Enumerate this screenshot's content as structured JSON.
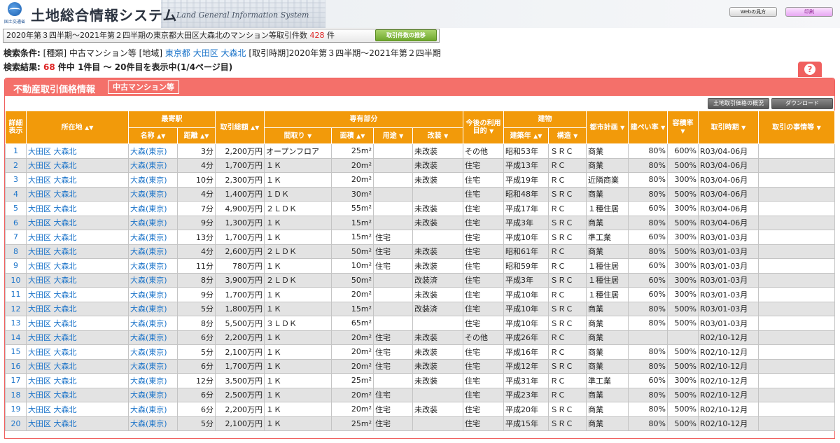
{
  "header": {
    "title": "土地総合情報システム",
    "subtitle": "Land General Information System",
    "logo_text": "国土交通省",
    "help_button": "Webの見方",
    "print_button": "印刷"
  },
  "summary": {
    "text": "2020年第３四半期～2021年第２四半期の東京都大田区大森北のマンション等取引件数",
    "count": "428",
    "unit": "件",
    "trend_button": "取引件数の推移"
  },
  "criteria": {
    "label": "検索条件:",
    "type": "[種類] 中古マンション等",
    "region_label": "[地域]",
    "region_pref": "東京都",
    "region_city": "大田区",
    "region_area": "大森北",
    "period": "[取引時期]2020年第３四半期～2021年第２四半期"
  },
  "results": {
    "label": "検索結果:",
    "count": "68",
    "text": "件中 1件目 ～ 20件目を表示中(1/4ページ目)"
  },
  "panel": {
    "title": "不動産取引価格情報",
    "tag": "中古マンション等",
    "land_button": "土地取引価格の概況",
    "download_button": "ダウンロード"
  },
  "table": {
    "headers": {
      "detail": "詳細表示",
      "location": "所在地",
      "station": "最寄駅",
      "station_name": "名称",
      "distance": "距離",
      "price": "取引総額",
      "section": "専有部分",
      "layout": "間取り",
      "area": "面積",
      "use": "用途",
      "renovation": "改装",
      "future_use": "今後の利用目的",
      "building": "建物",
      "built_year": "建築年",
      "structure": "構造",
      "city_plan": "都市計画",
      "coverage": "建ぺい率",
      "floor_ratio": "容積率",
      "period": "取引時期",
      "circumstances": "取引の事情等"
    },
    "rows": [
      {
        "no": "1",
        "loc": "大田区 大森北",
        "st": "大森(東京)",
        "dist": "3分",
        "price": "2,200万円",
        "layout": "オープンフロア",
        "area": "25m²",
        "use": "",
        "reno": "未改装",
        "future": "その他",
        "year": "昭和53年",
        "struct": "ＳＲＣ",
        "plan": "商業",
        "cov": "80%",
        "far": "600%",
        "period": "R03/04-06月"
      },
      {
        "no": "2",
        "loc": "大田区 大森北",
        "st": "大森(東京)",
        "dist": "4分",
        "price": "1,700万円",
        "layout": "１Ｋ",
        "area": "20m²",
        "use": "",
        "reno": "未改装",
        "future": "住宅",
        "year": "平成13年",
        "struct": "ＲＣ",
        "plan": "商業",
        "cov": "80%",
        "far": "500%",
        "period": "R03/04-06月"
      },
      {
        "no": "3",
        "loc": "大田区 大森北",
        "st": "大森(東京)",
        "dist": "10分",
        "price": "2,300万円",
        "layout": "１Ｋ",
        "area": "20m²",
        "use": "",
        "reno": "未改装",
        "future": "住宅",
        "year": "平成19年",
        "struct": "ＲＣ",
        "plan": "近隣商業",
        "cov": "80%",
        "far": "300%",
        "period": "R03/04-06月"
      },
      {
        "no": "4",
        "loc": "大田区 大森北",
        "st": "大森(東京)",
        "dist": "4分",
        "price": "1,400万円",
        "layout": "１ＤＫ",
        "area": "30m²",
        "use": "",
        "reno": "",
        "future": "住宅",
        "year": "昭和48年",
        "struct": "ＳＲＣ",
        "plan": "商業",
        "cov": "80%",
        "far": "500%",
        "period": "R03/04-06月"
      },
      {
        "no": "5",
        "loc": "大田区 大森北",
        "st": "大森(東京)",
        "dist": "7分",
        "price": "4,900万円",
        "layout": "２ＬＤＫ",
        "area": "55m²",
        "use": "",
        "reno": "未改装",
        "future": "住宅",
        "year": "平成17年",
        "struct": "ＲＣ",
        "plan": "１種住居",
        "cov": "60%",
        "far": "300%",
        "period": "R03/04-06月"
      },
      {
        "no": "6",
        "loc": "大田区 大森北",
        "st": "大森(東京)",
        "dist": "9分",
        "price": "1,300万円",
        "layout": "１Ｋ",
        "area": "15m²",
        "use": "",
        "reno": "未改装",
        "future": "住宅",
        "year": "平成3年",
        "struct": "ＳＲＣ",
        "plan": "商業",
        "cov": "80%",
        "far": "500%",
        "period": "R03/04-06月"
      },
      {
        "no": "7",
        "loc": "大田区 大森北",
        "st": "大森(東京)",
        "dist": "13分",
        "price": "1,700万円",
        "layout": "１Ｋ",
        "area": "15m²",
        "use": "住宅",
        "reno": "",
        "future": "住宅",
        "year": "平成10年",
        "struct": "ＳＲＣ",
        "plan": "準工業",
        "cov": "60%",
        "far": "300%",
        "period": "R03/01-03月"
      },
      {
        "no": "8",
        "loc": "大田区 大森北",
        "st": "大森(東京)",
        "dist": "4分",
        "price": "2,600万円",
        "layout": "２ＬＤＫ",
        "area": "50m²",
        "use": "住宅",
        "reno": "未改装",
        "future": "住宅",
        "year": "昭和61年",
        "struct": "ＲＣ",
        "plan": "商業",
        "cov": "80%",
        "far": "500%",
        "period": "R03/01-03月"
      },
      {
        "no": "9",
        "loc": "大田区 大森北",
        "st": "大森(東京)",
        "dist": "11分",
        "price": "780万円",
        "layout": "１Ｋ",
        "area": "10m²",
        "use": "住宅",
        "reno": "未改装",
        "future": "住宅",
        "year": "昭和59年",
        "struct": "ＲＣ",
        "plan": "１種住居",
        "cov": "60%",
        "far": "300%",
        "period": "R03/01-03月"
      },
      {
        "no": "10",
        "loc": "大田区 大森北",
        "st": "大森(東京)",
        "dist": "8分",
        "price": "3,900万円",
        "layout": "２ＬＤＫ",
        "area": "50m²",
        "use": "",
        "reno": "改装済",
        "future": "住宅",
        "year": "平成3年",
        "struct": "ＳＲＣ",
        "plan": "１種住居",
        "cov": "60%",
        "far": "300%",
        "period": "R03/01-03月"
      },
      {
        "no": "11",
        "loc": "大田区 大森北",
        "st": "大森(東京)",
        "dist": "9分",
        "price": "1,700万円",
        "layout": "１Ｋ",
        "area": "20m²",
        "use": "",
        "reno": "未改装",
        "future": "住宅",
        "year": "平成10年",
        "struct": "ＲＣ",
        "plan": "１種住居",
        "cov": "60%",
        "far": "300%",
        "period": "R03/01-03月"
      },
      {
        "no": "12",
        "loc": "大田区 大森北",
        "st": "大森(東京)",
        "dist": "5分",
        "price": "1,800万円",
        "layout": "１Ｋ",
        "area": "15m²",
        "use": "",
        "reno": "改装済",
        "future": "住宅",
        "year": "平成10年",
        "struct": "ＳＲＣ",
        "plan": "商業",
        "cov": "80%",
        "far": "500%",
        "period": "R03/01-03月"
      },
      {
        "no": "13",
        "loc": "大田区 大森北",
        "st": "大森(東京)",
        "dist": "8分",
        "price": "5,500万円",
        "layout": "３ＬＤＫ",
        "area": "65m²",
        "use": "",
        "reno": "",
        "future": "住宅",
        "year": "平成10年",
        "struct": "ＳＲＣ",
        "plan": "商業",
        "cov": "80%",
        "far": "500%",
        "period": "R03/01-03月"
      },
      {
        "no": "14",
        "loc": "大田区 大森北",
        "st": "大森(東京)",
        "dist": "6分",
        "price": "2,200万円",
        "layout": "１Ｋ",
        "area": "20m²",
        "use": "住宅",
        "reno": "未改装",
        "future": "その他",
        "year": "平成26年",
        "struct": "ＲＣ",
        "plan": "商業",
        "cov": "",
        "far": "",
        "period": "R02/10-12月"
      },
      {
        "no": "15",
        "loc": "大田区 大森北",
        "st": "大森(東京)",
        "dist": "5分",
        "price": "2,100万円",
        "layout": "１Ｋ",
        "area": "20m²",
        "use": "住宅",
        "reno": "未改装",
        "future": "住宅",
        "year": "平成16年",
        "struct": "ＲＣ",
        "plan": "商業",
        "cov": "80%",
        "far": "500%",
        "period": "R02/10-12月"
      },
      {
        "no": "16",
        "loc": "大田区 大森北",
        "st": "大森(東京)",
        "dist": "6分",
        "price": "1,700万円",
        "layout": "１Ｋ",
        "area": "20m²",
        "use": "住宅",
        "reno": "未改装",
        "future": "住宅",
        "year": "平成12年",
        "struct": "ＳＲＣ",
        "plan": "商業",
        "cov": "80%",
        "far": "500%",
        "period": "R02/10-12月"
      },
      {
        "no": "17",
        "loc": "大田区 大森北",
        "st": "大森(東京)",
        "dist": "12分",
        "price": "3,500万円",
        "layout": "１Ｋ",
        "area": "25m²",
        "use": "",
        "reno": "未改装",
        "future": "住宅",
        "year": "平成31年",
        "struct": "ＲＣ",
        "plan": "準工業",
        "cov": "60%",
        "far": "300%",
        "period": "R02/10-12月"
      },
      {
        "no": "18",
        "loc": "大田区 大森北",
        "st": "大森(東京)",
        "dist": "6分",
        "price": "2,500万円",
        "layout": "１Ｋ",
        "area": "20m²",
        "use": "住宅",
        "reno": "",
        "future": "住宅",
        "year": "平成23年",
        "struct": "ＲＣ",
        "plan": "商業",
        "cov": "80%",
        "far": "500%",
        "period": "R02/10-12月"
      },
      {
        "no": "19",
        "loc": "大田区 大森北",
        "st": "大森(東京)",
        "dist": "6分",
        "price": "2,200万円",
        "layout": "１Ｋ",
        "area": "20m²",
        "use": "住宅",
        "reno": "未改装",
        "future": "住宅",
        "year": "平成20年",
        "struct": "ＳＲＣ",
        "plan": "商業",
        "cov": "80%",
        "far": "500%",
        "period": "R02/10-12月"
      },
      {
        "no": "20",
        "loc": "大田区 大森北",
        "st": "大森(東京)",
        "dist": "5分",
        "price": "2,100万円",
        "layout": "１Ｋ",
        "area": "25m²",
        "use": "住宅",
        "reno": "",
        "future": "住宅",
        "year": "平成15年",
        "struct": "ＳＲＣ",
        "plan": "商業",
        "cov": "80%",
        "far": "500%",
        "period": "R02/10-12月"
      }
    ]
  },
  "colors": {
    "accent": "#f4706a",
    "header_orange": "#f29a0a",
    "link": "#1a73c9",
    "highlight": "#dd2222"
  }
}
